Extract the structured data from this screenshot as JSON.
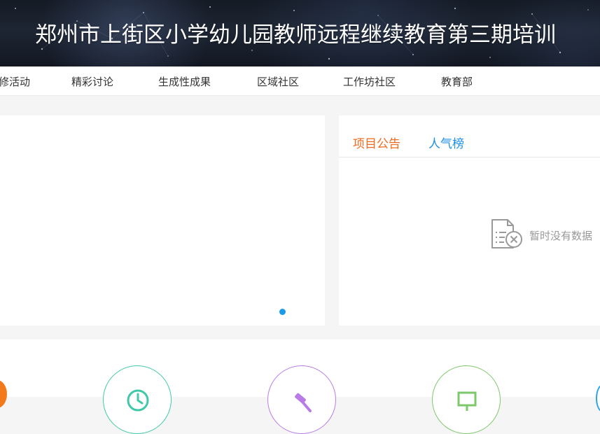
{
  "banner": {
    "title": "郑州市上街区小学幼儿园教师远程继续教育第三期培训"
  },
  "nav": {
    "items": [
      {
        "label": "修活动"
      },
      {
        "label": "精彩讨论"
      },
      {
        "label": "生成性成果"
      },
      {
        "label": "区域社区"
      },
      {
        "label": "工作坊社区"
      },
      {
        "label": "教育部"
      }
    ]
  },
  "notice": {
    "tabs": [
      {
        "label": "项目公告"
      },
      {
        "label": "人气榜"
      }
    ],
    "empty_text": "暂时没有数据"
  },
  "colors": {
    "accent_orange": "#f06a1f",
    "accent_blue": "#1a8fe3",
    "carousel_dot": "#1a9be8",
    "circle_teal": "#3fc9a8",
    "circle_purple": "#b97ce6",
    "circle_green": "#7dc86a"
  },
  "icons": {
    "empty": "empty-document-icon",
    "quick_links": [
      "clock-icon",
      "hammer-icon",
      "board-icon"
    ]
  }
}
